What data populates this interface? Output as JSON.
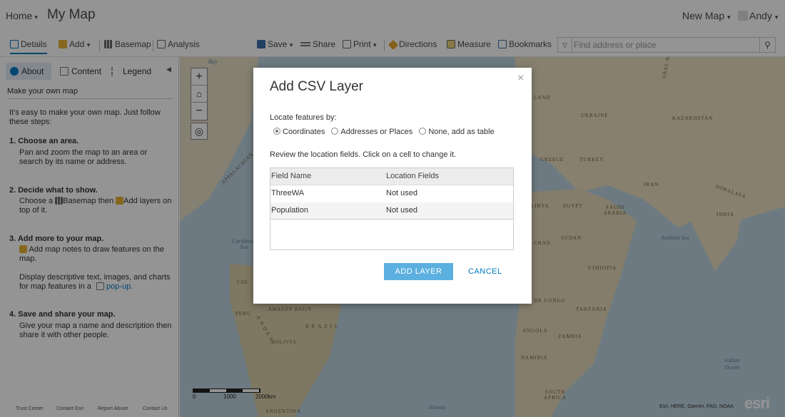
{
  "header": {
    "home_label": "Home",
    "map_title": "My Map",
    "new_map_label": "New Map",
    "user_name": "Andy"
  },
  "toolbar": {
    "details": "Details",
    "add": "Add",
    "basemap": "Basemap",
    "analysis": "Analysis",
    "save": "Save",
    "share": "Share",
    "print": "Print",
    "directions": "Directions",
    "measure": "Measure",
    "bookmarks": "Bookmarks",
    "search_placeholder": "Find address or place"
  },
  "panel": {
    "tabs": {
      "about": "About",
      "content": "Content",
      "legend": "Legend"
    },
    "subtitle": "Make your own map",
    "intro": "It's easy to make your own map. Just follow these steps:",
    "step1_title": "1. Choose an area.",
    "step1_text": "Pan and zoom the map to an area or search by its name or address.",
    "step2_title": "2. Decide what to show.",
    "step2_a": "Choose a",
    "step2_b": "Basemap then",
    "step2_c": "Add layers on top of it.",
    "step3_title": "3. Add more to your map.",
    "step3_a": "Add map notes to draw features on the map.",
    "step3_b": "Display descriptive text, images, and charts for map features in a",
    "step3_link": "pop-up.",
    "step4_title": "4. Save and share your map.",
    "step4_text": "Give your map a name and description then share it with other people.",
    "footer": [
      "Trust Center",
      "Contact Esri",
      "Report Abuse",
      "Contact Us"
    ]
  },
  "map": {
    "labels": {
      "england": "LAND",
      "ukraine": "UKRAINE",
      "kazakhstan": "KAZAKHSTAN",
      "greece": "GREECE",
      "turkey": "TURKEY",
      "iran": "IRAN",
      "himalaya": "HIMALAYA",
      "libya": "LIBYA",
      "egypt": "EGYPT",
      "saudi": "SAUDI ARABIA",
      "india": "INDIA",
      "chad": "CHAD",
      "sudan": "SUDAN",
      "arabian_sea": "Arabian Sea",
      "ethiopia": "ETHIOPIA",
      "drcongo": "DR CONGO",
      "tanzania": "TANZANIA",
      "angola": "ANGOLA",
      "zambia": "ZAMBIA",
      "namibia": "NAMIBIA",
      "southafrica": "SOUTH AFRICA",
      "indian_ocean": "Indian Ocean",
      "amazon": "AMAZON BASIN",
      "brazil": "BRAZIL",
      "peru": "PERU",
      "bolivia": "BOLIVIA",
      "argentina": "ARGENTINA",
      "atlantic": "Atlantic",
      "andes": "ANDES",
      "col": "COL",
      "appalachian": "APPALACHIAN MTS",
      "ural": "URAL M",
      "bay": "Bay",
      "caribbean": "Caribbean Sea"
    },
    "scale_labels": [
      "0",
      "1000",
      "2000km"
    ],
    "attribution": "Esri, HERE, Garmin, FAO, NOAA",
    "logo": "esri",
    "ocean_color": "#bcd3df",
    "land_color": "#e8dcc0"
  },
  "dialog": {
    "title": "Add CSV Layer",
    "locate_label": "Locate features by:",
    "options": [
      "Coordinates",
      "Addresses or Places",
      "None, add as table"
    ],
    "selected_option": "Coordinates",
    "review_text": "Review the location fields. Click on a cell to change it.",
    "table": {
      "headers": [
        "Field Name",
        "Location Fields"
      ],
      "rows": [
        [
          "ThreeWA",
          "Not used"
        ],
        [
          "Population",
          "Not used"
        ]
      ]
    },
    "add_button": "ADD LAYER",
    "cancel_button": "CANCEL"
  }
}
